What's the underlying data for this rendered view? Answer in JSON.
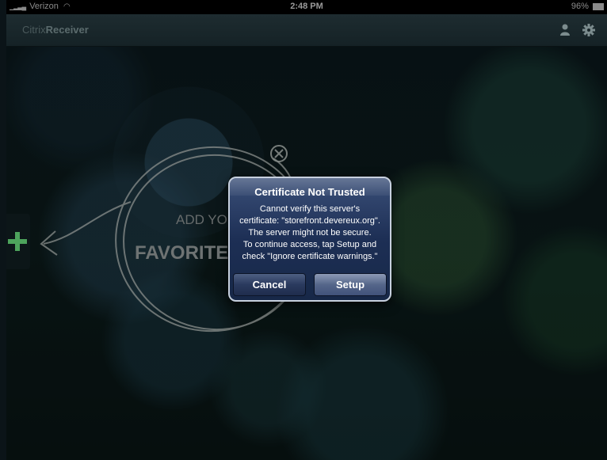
{
  "status_bar": {
    "carrier": "Verizon",
    "time": "2:48 PM",
    "battery": "96%"
  },
  "header": {
    "title_light": "Citrix",
    "title_bold": "Receiver"
  },
  "background": {
    "hint_line1": "ADD YO",
    "hint_line2": "FAVORITE"
  },
  "dialog": {
    "title": "Certificate Not Trusted",
    "message_lines": [
      "Cannot verify this server's",
      "certificate: \"storefront.devereux.org\".",
      "The server might not be secure.",
      "To continue access, tap Setup and",
      "check \"Ignore certificate warnings.\""
    ],
    "cancel_label": "Cancel",
    "setup_label": "Setup"
  }
}
